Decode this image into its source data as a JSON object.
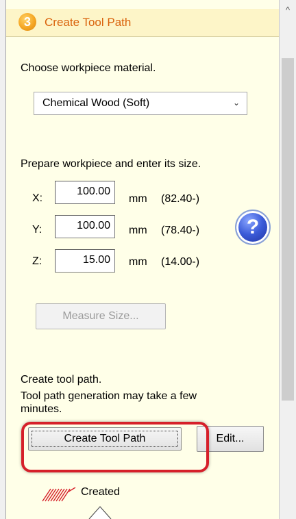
{
  "header": {
    "step_number": "3",
    "title": "Create Tool Path"
  },
  "material": {
    "label": "Choose workpiece material.",
    "selected": "Chemical Wood (Soft)"
  },
  "size": {
    "label": "Prepare workpiece and enter its size.",
    "fields": [
      {
        "axis": "X:",
        "value": "100.00",
        "unit": "mm",
        "range": "(82.40-)"
      },
      {
        "axis": "Y:",
        "value": "100.00",
        "unit": "mm",
        "range": "(78.40-)"
      },
      {
        "axis": "Z:",
        "value": "15.00",
        "unit": "mm",
        "range": "(14.00-)"
      }
    ],
    "help_glyph": "?",
    "measure_button": "Measure Size..."
  },
  "toolpath": {
    "label": "Create tool path.",
    "note_line1": "Tool path generation may take a few",
    "note_line2": "minutes.",
    "create_button": "Create Tool Path",
    "edit_button": "Edit...",
    "status": "Created"
  },
  "colors": {
    "panel_bg": "#ffffe8",
    "header_bg": "#fdf5c8",
    "title_orange": "#d9610a",
    "highlight_red": "#d6202a",
    "help_blue": "#3b5bd8"
  },
  "scrollbar": {
    "up_arrow_icon": "chevron-up-icon"
  }
}
